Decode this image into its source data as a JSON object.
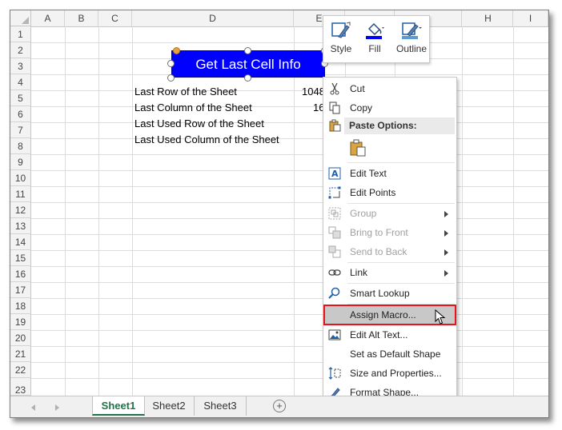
{
  "columns": [
    "A",
    "B",
    "C",
    "D",
    "E",
    "",
    "",
    "H",
    "I"
  ],
  "rows": [
    "1",
    "2",
    "3",
    "4",
    "5",
    "6",
    "7",
    "8",
    "9",
    "10",
    "11",
    "12",
    "13",
    "14",
    "15",
    "16",
    "17",
    "18",
    "19",
    "20",
    "21",
    "22",
    "23"
  ],
  "cells": {
    "d4": "Last Row of the Sheet",
    "d5": "Last Column of the Sheet",
    "d6": "Last Used Row of the Sheet",
    "d7": "Last Used Column of the Sheet",
    "e4": "1048",
    "e5": "16"
  },
  "shape": {
    "label": "Get Last Cell Info",
    "fill_color": "#0000ff"
  },
  "mini_toolbar": {
    "style": "Style",
    "fill": "Fill",
    "outline": "Outline"
  },
  "context_menu": {
    "cut": "Cut",
    "copy": "Copy",
    "paste_options": "Paste Options:",
    "edit_text": "Edit Text",
    "edit_points": "Edit Points",
    "group": "Group",
    "bring_to_front": "Bring to Front",
    "send_to_back": "Send to Back",
    "link": "Link",
    "smart_lookup": "Smart Lookup",
    "assign_macro": "Assign Macro...",
    "edit_alt_text": "Edit Alt Text...",
    "set_default_shape": "Set as Default Shape",
    "size_and_properties": "Size and Properties...",
    "format_shape": "Format Shape..."
  },
  "sheet_tabs": [
    "Sheet1",
    "Sheet2",
    "Sheet3"
  ],
  "colors": {
    "accent_green": "#217346",
    "highlight_red": "#e8141c"
  }
}
